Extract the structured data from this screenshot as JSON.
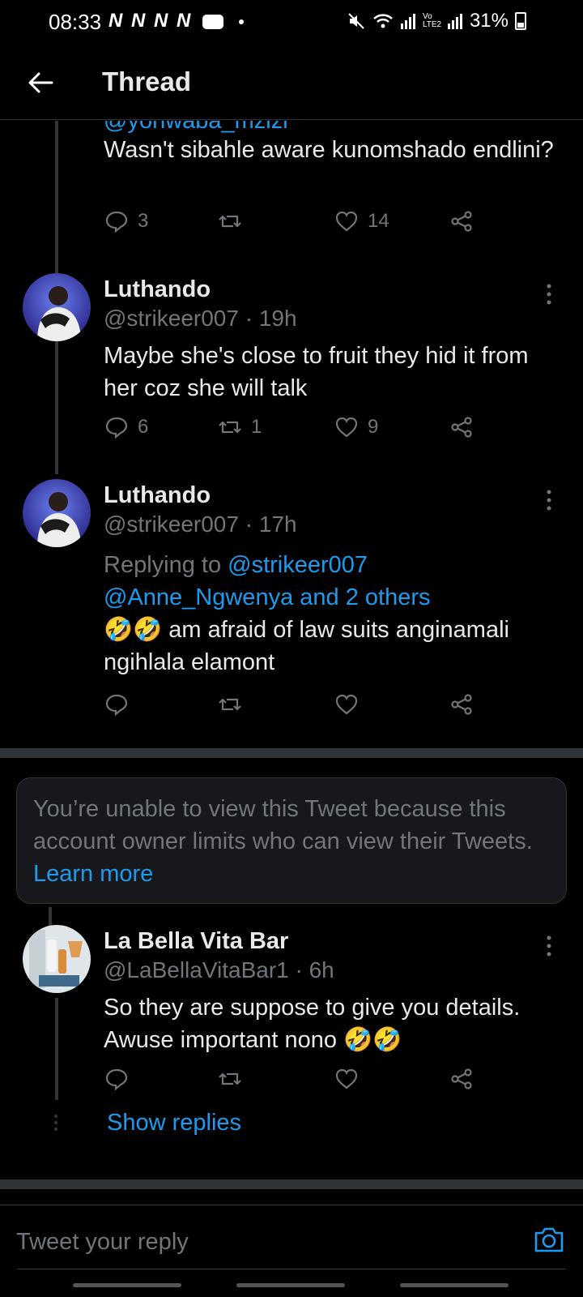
{
  "status_bar": {
    "time": "08:33",
    "left_icons": "N N N N",
    "battery": "31%",
    "signal_label": "Vo LTE2"
  },
  "header": {
    "title": "Thread"
  },
  "top_tweet": {
    "clipped_mention": "@yonwaba_mzizi",
    "text": "Wasn't sibahle aware kunomshado endlini?",
    "replies": "3",
    "retweets": "",
    "likes": "14"
  },
  "tweets": [
    {
      "name": "Luthando",
      "handle_time": "@strikeer007 · 19h",
      "text": "Maybe she's close to fruit they hid it from her coz she will talk",
      "replies": "6",
      "retweets": "1",
      "likes": "9"
    },
    {
      "name": "Luthando",
      "handle_time": "@strikeer007 · 17h",
      "replying_prefix": "Replying to ",
      "replying_link1": "@strikeer007",
      "replying_link2": "@Anne_Ngwenya and 2 others",
      "text": "🤣🤣 am afraid of law suits anginamali ngihlala elamont",
      "replies": "",
      "retweets": "",
      "likes": ""
    }
  ],
  "limited_notice": {
    "text": "You’re unable to view this Tweet because this account owner limits who can view their Tweets. ",
    "link": "Learn more"
  },
  "bella_tweet": {
    "name": "La Bella Vita Bar",
    "handle_time": "@LaBellaVitaBar1 · 6h",
    "text": "So they are suppose to give you details. Awuse important nono 🤣🤣",
    "replies": "",
    "retweets": "",
    "likes": ""
  },
  "show_replies": "Show replies",
  "reply_bar": {
    "placeholder": "Tweet your reply"
  },
  "colors": {
    "accent": "#1d9bf0",
    "muted": "#71767b",
    "background": "#000000"
  }
}
